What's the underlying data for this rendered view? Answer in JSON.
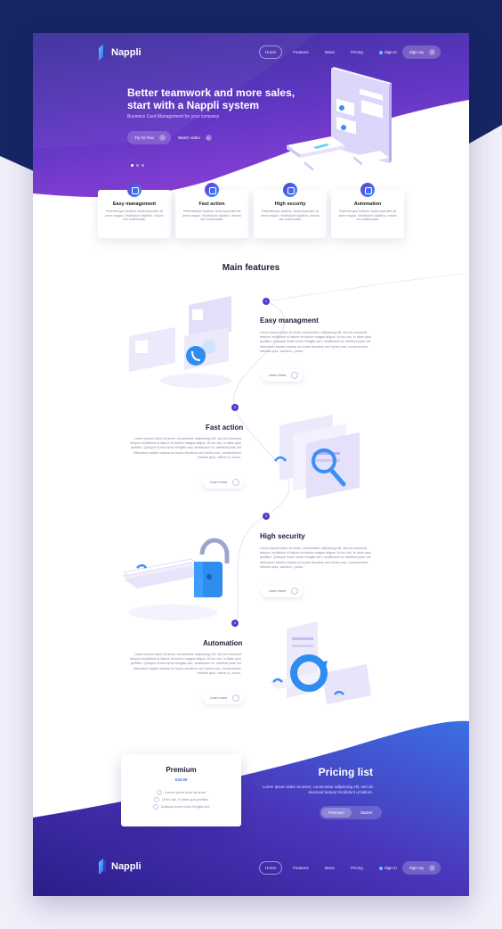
{
  "brand": {
    "name": "Nappli"
  },
  "nav": {
    "items": [
      "Home",
      "Features",
      "News",
      "Pricing"
    ],
    "sign_in": "Sign In",
    "sign_up": "Sign Up"
  },
  "hero": {
    "title": "Better teamwork and more sales, start with a Nappli system",
    "subtitle": "Business Card Management for your company",
    "try_label": "Try for free",
    "watch_label": "Watch video",
    "slide_index": 1
  },
  "benefits": [
    {
      "title": "Easy management",
      "text": "Pellentesque facilisis. Nulla imperdiet sit amet magna. Vestibulum dapibus, mauris nec malesuada.",
      "icon": "hand-icon"
    },
    {
      "title": "Fast action",
      "text": "Pellentesque facilisis. Nulla imperdiet sit amet magna. Vestibulum dapibus, mauris nec malesuada.",
      "icon": "bolt-icon"
    },
    {
      "title": "High security",
      "text": "Pellentesque facilisis. Nulla imperdiet sit amet magna. Vestibulum dapibus, mauris nec malesuada.",
      "icon": "bulb-icon"
    },
    {
      "title": "Automation",
      "text": "Pellentesque facilisis. Nulla imperdiet sit amet magna. Vestibulum dapibus, mauris nec malesuada.",
      "icon": "refresh-icon"
    }
  ],
  "features": {
    "title": "Main features",
    "learn_more": "Learn more",
    "items": [
      {
        "num": "1",
        "title": "Easy managment",
        "text": "Lorem ipsum dolor sit amet, consectetur adipiscing elit, sed do eiusmod tempor incididunt ut labore et dolore magna aliqua. Ut leo dui, in diam quis porttitor. Quisque lorem tortor fringilla sed, vestibulum id, eleifend justo vel bibendum sapien massa ac turpis faucibus orci luctus non, consectetuer lobortis quis, varius in, purus."
      },
      {
        "num": "2",
        "title": "Fast action",
        "text": "Lorem ipsum dolor sit amet, consectetur adipiscing elit, sed do eiusmod tempor incididunt ut labore et dolore magna aliqua. Ut leo dui, in diam quis porttitor. Quisque lorem tortor fringilla sed, vestibulum id, eleifend justo vel bibendum sapien massa ac turpis faucibus orci luctus non, consectetuer lobortis quis, varius in, purus."
      },
      {
        "num": "3",
        "title": "High security",
        "text": "Lorem ipsum dolor sit amet, consectetur adipiscing elit, sed do eiusmod tempor incididunt ut labore et dolore magna aliqua. Ut leo dui, in diam quis porttitor. Quisque lorem tortor fringilla sed, vestibulum id, eleifend justo vel bibendum sapien massa ac turpis faucibus orci luctus non, consectetuer lobortis quis, varius in, purus."
      },
      {
        "num": "4",
        "title": "Automation",
        "text": "Lorem ipsum dolor sit amet, consectetur adipiscing elit, sed do eiusmod tempor incididunt ut labore et dolore magna aliqua. Ut leo dui, in diam quis porttitor. Quisque lorem tortor fringilla sed, vestibulum id, eleifend justo vel bibendum sapien massa ac turpis faucibus orci luctus non, consectetuer lobortis quis, varius in, purus."
      }
    ]
  },
  "pricing": {
    "title": "Pricing list",
    "text": "Lorem ipsum dolor sit amet, consectetur adipiscing elit, sed do eiusmod tempor incididunt ut labore.",
    "card": {
      "name": "Premium",
      "price": "$49.99",
      "features": [
        "Lorem ipsum dolor sit amet",
        "Ut leo dui, in diam quis porttitor",
        "Quisque lorem tortor fringilla sed"
      ]
    },
    "toggle": [
      "Premium",
      "Starter"
    ],
    "toggle_selected": "Premium"
  },
  "colors": {
    "navy": "#162563",
    "purple": "#6a3ccf",
    "indigo": "#3d2c9e",
    "blue": "#3f8ef5",
    "text_dark": "#1e1c3a"
  }
}
